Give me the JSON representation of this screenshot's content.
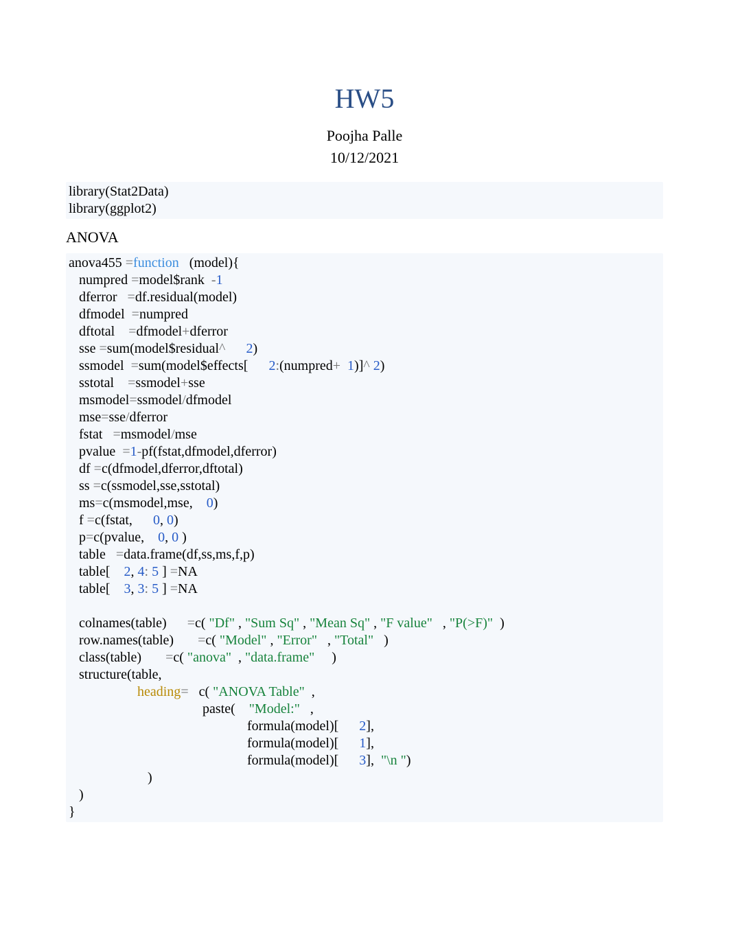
{
  "title": "HW5",
  "author": "Poojha Palle",
  "date": "10/12/2021",
  "section_heading": "ANOVA",
  "code_block_1": {
    "line1_a": "library(Stat2Data)",
    "line2_a": "library(ggplot2)"
  },
  "code_block_2": {
    "l01": {
      "t1": "anova455 ",
      "op1": "=",
      "fn": "function",
      "t2": "   (model){"
    },
    "l02": {
      "t1": "   numpred ",
      "op1": "=",
      "t2": "model$rank  ",
      "op2": "-",
      "n1": "1"
    },
    "l03": {
      "t1": "   dferror   ",
      "op1": "=",
      "t2": "df.residual(model)"
    },
    "l04": {
      "t1": "   dfmodel  ",
      "op1": "=",
      "t2": "numpred"
    },
    "l05": {
      "t1": "   dftotal    ",
      "op1": "=",
      "t2": "dfmodel",
      "op2": "+",
      "t3": "dferror"
    },
    "l06": {
      "t1": "   sse ",
      "op1": "=",
      "t2": "sum(model$residual",
      "op2": "^",
      "t3": "      ",
      "n1": "2",
      "t4": ")"
    },
    "l07": {
      "t1": "   ssmodel  ",
      "op1": "=",
      "t2": "sum(model$effects[      ",
      "n1": "2",
      "op2": ":",
      "t3": "(numpred",
      "op3": "+",
      "t4": "  ",
      "n2": "1",
      "t5": ")]",
      "op4": "^",
      "t6": " ",
      "n3": "2",
      "t7": ")"
    },
    "l08": {
      "t1": "   sstotal    ",
      "op1": "=",
      "t2": "ssmodel",
      "op2": "+",
      "t3": "sse"
    },
    "l09": {
      "t1": "   msmodel",
      "op1": "=",
      "t2": "ssmodel",
      "op2": "/",
      "t3": "dfmodel"
    },
    "l10": {
      "t1": "   mse",
      "op1": "=",
      "t2": "sse",
      "op2": "/",
      "t3": "dferror"
    },
    "l11": {
      "t1": "   fstat   ",
      "op1": "=",
      "t2": "msmodel",
      "op2": "/",
      "t3": "mse"
    },
    "l12": {
      "t1": "   pvalue  ",
      "op1": "=",
      "n1": "1",
      "op2": "-",
      "t2": "pf(fstat,dfmodel,dferror)"
    },
    "l13": {
      "t1": "   df ",
      "op1": "=",
      "t2": "c(dfmodel,dferror,dftotal)"
    },
    "l14": {
      "t1": "   ss ",
      "op1": "=",
      "t2": "c(ssmodel,sse,sstotal)"
    },
    "l15": {
      "t1": "   ms",
      "op1": "=",
      "t2": "c(msmodel,mse,    ",
      "n1": "0",
      "t3": ")"
    },
    "l16": {
      "t1": "   f ",
      "op1": "=",
      "t2": "c(fstat,      ",
      "n1": "0",
      "t3": ", ",
      "n2": "0",
      "t4": ")"
    },
    "l17": {
      "t1": "   p",
      "op1": "=",
      "t2": "c(pvalue,    ",
      "n1": "0",
      "t3": ", ",
      "n2": "0",
      "t4": " )"
    },
    "l18": {
      "t1": "   table   ",
      "op1": "=",
      "t2": "data.frame(df,ss,ms,f,p)"
    },
    "l19": {
      "t1": "   table[    ",
      "n1": "2",
      "t2": ", ",
      "n2": "4",
      "op1": ":",
      "t3": " ",
      "n3": "5",
      "t4": " ] ",
      "op2": "=",
      "t5": "NA"
    },
    "l20": {
      "t1": "   table[    ",
      "n1": "3",
      "t2": ", ",
      "n2": "3",
      "op1": ":",
      "t3": " ",
      "n3": "5",
      "t4": " ] ",
      "op2": "=",
      "t5": "NA"
    },
    "l21": {
      "t1": " "
    },
    "l22": {
      "t1": "   colnames(table)      ",
      "op1": "=",
      "t2": "c( ",
      "s1": "\"Df\"",
      "t3": " , ",
      "s2": "\"Sum Sq\"",
      "t4": " , ",
      "s3": "\"Mean Sq\"",
      "t5": " , ",
      "s4": "\"F value\"",
      "t6": "   , ",
      "s5": "\"P(>F)\"",
      "t7": "  )"
    },
    "l23": {
      "t1": "   row.names(table)       ",
      "op1": "=",
      "t2": "c( ",
      "s1": "\"Model\"",
      "t3": " , ",
      "s2": "\"Error\"",
      "t4": "   , ",
      "s3": "\"Total\"",
      "t5": "   )"
    },
    "l24": {
      "t1": "   class(table)       ",
      "op1": "=",
      "t2": "c( ",
      "s1": "\"anova\"",
      "t3": "  , ",
      "s2": "\"data.frame\"",
      "t4": "     )"
    },
    "l25": {
      "t1": "   structure(table,"
    },
    "l26": {
      "t1": "                    ",
      "arg": "heading",
      "op1": "=",
      "t2": "   c( ",
      "s1": "\"ANOVA Table\"",
      "t3": "  ,"
    },
    "l27": {
      "t1": "                                       paste(    ",
      "s1": "\"Model:\"",
      "t2": "   ,"
    },
    "l28": {
      "t1": "                                                    formula(model)[      ",
      "n1": "2",
      "t2": "],"
    },
    "l29": {
      "t1": "                                                    formula(model)[      ",
      "n1": "1",
      "t2": "],"
    },
    "l30": {
      "t1": "                                                    formula(model)[      ",
      "n1": "3",
      "t2": "],  ",
      "s1": "\"\\n \"",
      "t3": ")"
    },
    "l31": {
      "t1": "                       )"
    },
    "l32": {
      "t1": "   )"
    },
    "l33": {
      "t1": "}"
    }
  }
}
